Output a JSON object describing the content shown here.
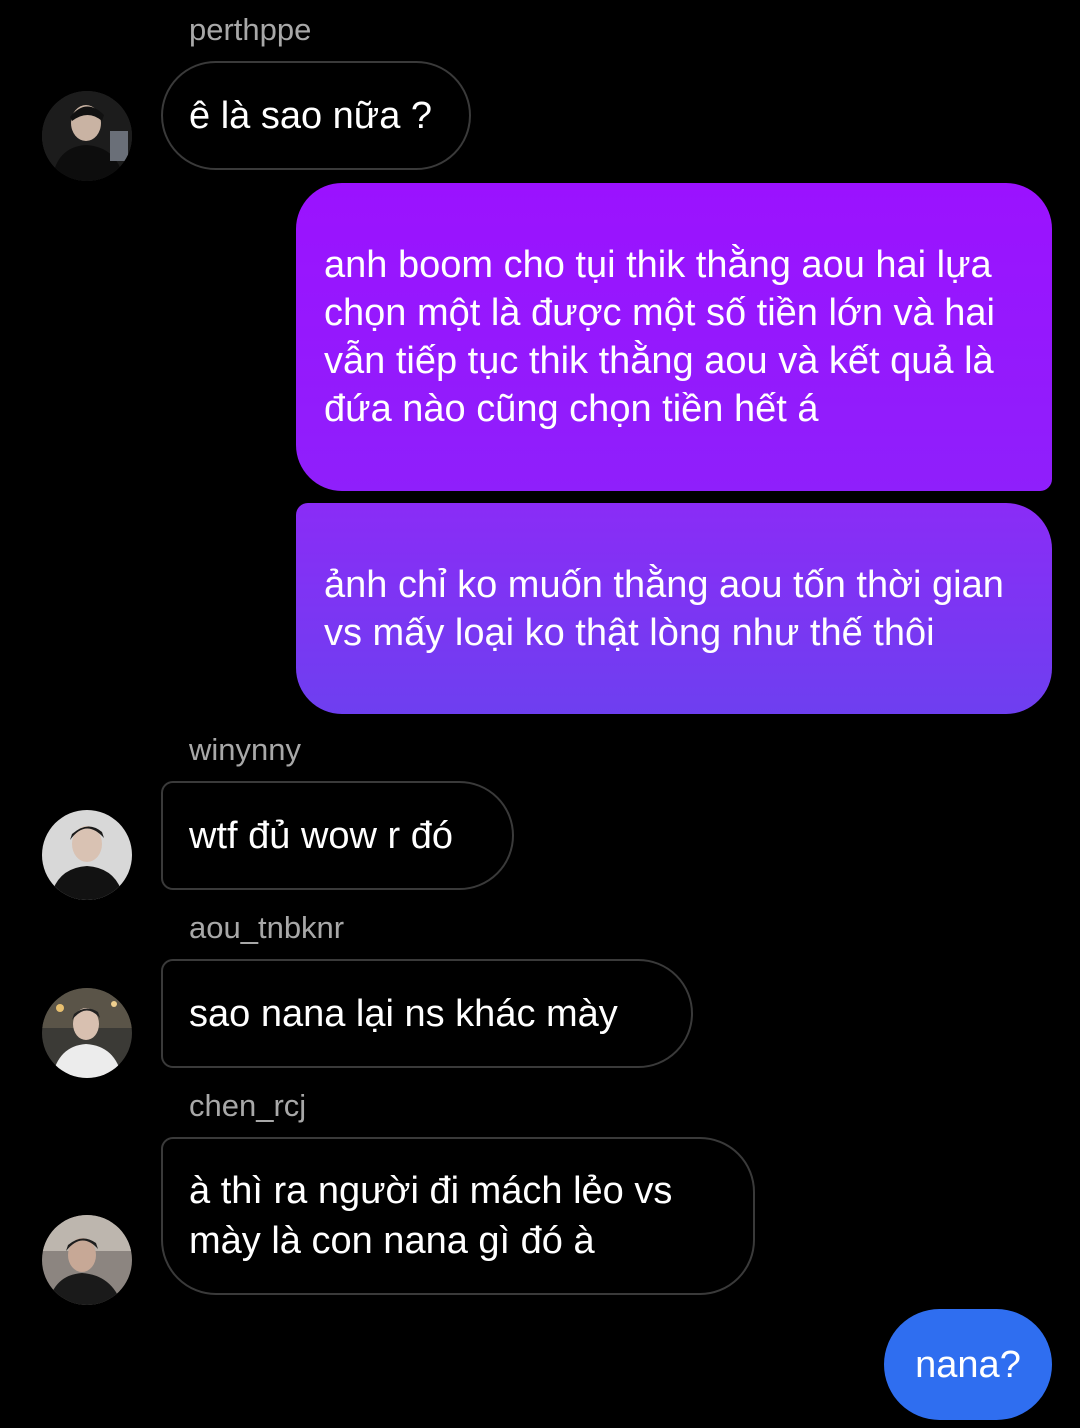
{
  "messages": [
    {
      "sender": "perthppe",
      "text": "ê là sao nữa ?",
      "outgoing": false
    },
    {
      "sender": "",
      "text": "anh boom cho tụi thik thằng aou hai lựa chọn một là được một số tiền lớn và hai vẫn tiếp tục thik thằng aou và kết quả là đứa nào cũng chọn tiền hết á",
      "outgoing": true
    },
    {
      "sender": "",
      "text": "ảnh chỉ ko muốn thằng aou tốn thời gian vs mấy loại ko thật lòng như thế thôi",
      "outgoing": true
    },
    {
      "sender": "winynny",
      "text": "wtf đủ wow r đó",
      "outgoing": false
    },
    {
      "sender": "aou_tnbknr",
      "text": "sao nana lại ns khác mày",
      "outgoing": false
    },
    {
      "sender": "chen_rcj",
      "text": "à thì ra người đi mách lẻo vs mày là con nana gì đó à",
      "outgoing": false
    },
    {
      "sender": "",
      "text": "nana?",
      "outgoing": true
    }
  ],
  "colors": {
    "background": "#000000",
    "incoming_border": "#3a3a3a",
    "username_gray": "#a8a8a8",
    "gradient_top": "#9b12ff",
    "gradient_mid": "#8a2cf6",
    "gradient_bottom": "#6e3ff0",
    "outgoing_blue": "#2f6ef0"
  }
}
